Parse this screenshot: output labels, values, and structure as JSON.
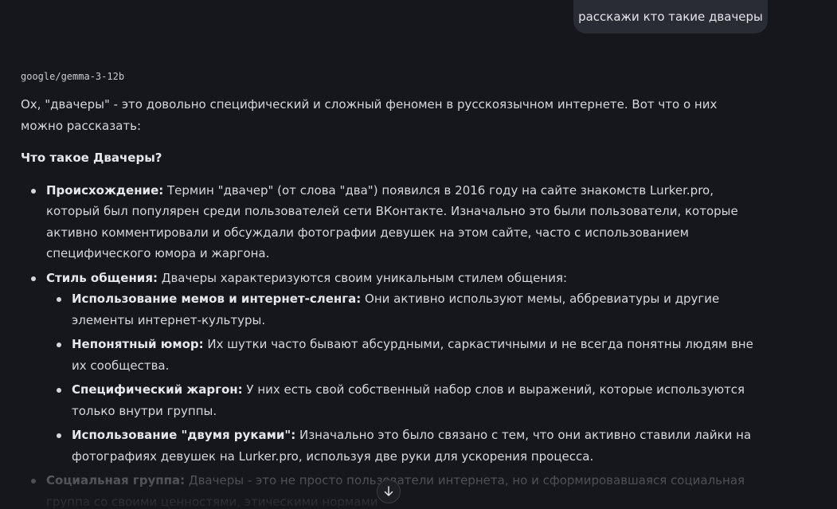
{
  "user_message": "расскажи кто такие двачеры",
  "model_name": "google/gemma-3-12b",
  "answer": {
    "intro": "Ох, \"двачеры\" - это довольно специфический и сложный феномен в русскоязычном интернете. Вот что о них можно рассказать:",
    "heading": "Что такое Двачеры?",
    "items": [
      {
        "label": "Происхождение:",
        "text": " Термин \"двачер\" (от слова \"два\") появился в 2016 году на сайте знакомств Lurker.pro, который был популярен среди пользователей сети ВКонтакте. Изначально это были пользователи, которые активно комментировали и обсуждали фотографии девушек на этом сайте, часто с использованием специфического юмора и жаргона."
      },
      {
        "label": "Стиль общения:",
        "text": " Двачеры характеризуются своим уникальным стилем общения:",
        "subitems": [
          {
            "label": "Использование мемов и интернет-сленга:",
            "text": " Они активно используют мемы, аббревиатуры и другие элементы интернет-культуры."
          },
          {
            "label": "Непонятный юмор:",
            "text": " Их шутки часто бывают абсурдными, саркастичными и не всегда понятны людям вне их сообщества."
          },
          {
            "label": "Специфический жаргон:",
            "text": " У них есть свой собственный набор слов и выражений, которые используются только внутри группы."
          },
          {
            "label": "Использование \"двумя руками\":",
            "text": " Изначально это было связано с тем, что они активно ставили лайки на фотографиях девушек на Lurker.pro, используя две руки для ускорения процесса."
          }
        ]
      },
      {
        "label": "Социальная группа:",
        "text": " Двачеры - это не просто пользователи интернета, но и сформировавшаяся социальная группа со своими ценностями, этическими нормами"
      }
    ]
  },
  "icons": {
    "scroll_down": "arrow-down-icon"
  }
}
